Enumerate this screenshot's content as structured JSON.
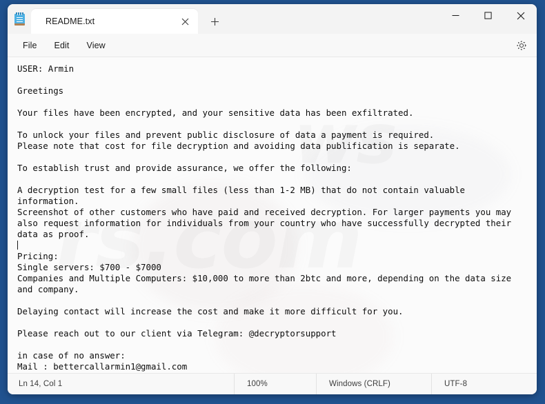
{
  "window": {
    "tab_title": "README.txt",
    "app_icon": "notepad-icon",
    "new_tab_label": "+",
    "controls": {
      "minimize": "minimize-icon",
      "maximize": "maximize-icon",
      "close": "close-icon"
    }
  },
  "menubar": {
    "items": [
      {
        "label": "File"
      },
      {
        "label": "Edit"
      },
      {
        "label": "View"
      }
    ],
    "settings_icon": "gear-icon"
  },
  "document": {
    "body": "USER: Armin\n\nGreetings\n\nYour files have been encrypted, and your sensitive data has been exfiltrated.\n\nTo unlock your files and prevent public disclosure of data a payment is required.\nPlease note that cost for file decryption and avoiding data publification is separate.\n\nTo establish trust and provide assurance, we offer the following:\n\nA decryption test for a few small files (less than 1-2 MB) that do not contain valuable\ninformation.\nScreenshot of other customers who have paid and received decryption. For larger payments you may\nalso request information for individuals from your country who have successfully decrypted their\ndata as proof.\n",
    "body_after_caret": "\nPricing:\nSingle servers: $700 - $7000\nCompanies and Multiple Computers: $10,000 to more than 2btc and more, depending on the data size\nand company.\n\nDelaying contact will increase the cost and make it more difficult for you.\n\nPlease reach out to our client via Telegram: @decryptorsupport\n\nin case of no answer:\nMail : bettercallarmin1@gmail.com",
    "lines": [
      "USER: Armin",
      "",
      "Greetings",
      "",
      "Your files have been encrypted, and your sensitive data has been exfiltrated.",
      "",
      "To unlock your files and prevent public disclosure of data a payment is required.",
      "Please note that cost for file decryption and avoiding data publification is separate.",
      "",
      "To establish trust and provide assurance, we offer the following:",
      "",
      "A decryption test for a few small files (less than 1-2 MB) that do not contain valuable",
      "information.",
      "Screenshot of other customers who have paid and received decryption. For larger payments you may",
      "also request information for individuals from your country who have successfully decrypted their",
      "data as proof.",
      "",
      "Pricing:",
      "Single servers: $700 - $7000",
      "Companies and Multiple Computers: $10,000 to more than 2btc and more, depending on the data size",
      "and company.",
      "",
      "Delaying contact will increase the cost and make it more difficult for you.",
      "",
      "Please reach out to our client via Telegram: @decryptorsupport",
      "",
      "in case of no answer:",
      "Mail : bettercallarmin1@gmail.com"
    ],
    "watermark_text_1": "rs.com",
    "watermark_text_2": "ws"
  },
  "statusbar": {
    "cursor_position": "Ln 14, Col 1",
    "zoom": "100%",
    "line_ending": "Windows (CRLF)",
    "encoding": "UTF-8"
  },
  "colors": {
    "desktop": "#20528f",
    "window_bg": "#f5f5f5",
    "titlebar": "#f3f3f3",
    "tab_active": "#ffffff",
    "editor_bg": "#fbfbfb",
    "text": "#0c0c0c",
    "icon_blue": "#4db0e3",
    "icon_base": "#b08052"
  }
}
